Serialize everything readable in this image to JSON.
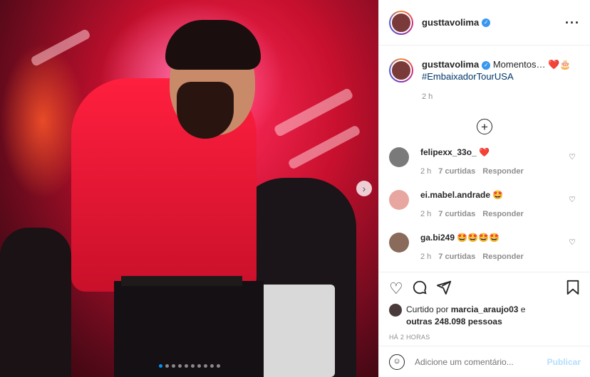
{
  "post": {
    "author": "gusttavolima",
    "caption_text": "Momentos… ",
    "caption_emoji": "❤️🎂",
    "hashtag": "#EmbaixadorTourUSA",
    "time": "2 h"
  },
  "comments": [
    {
      "user": "felipexx_33o_",
      "text": "❤️",
      "time": "2 h",
      "likes": "7 curtidas",
      "reply": "Responder"
    },
    {
      "user": "ei.mabel.andrade",
      "text": "🤩",
      "time": "2 h",
      "likes": "7 curtidas",
      "reply": "Responder"
    },
    {
      "user": "ga.bi249",
      "text": "🤩🤩🤩🤩",
      "time": "2 h",
      "likes": "7 curtidas",
      "reply": "Responder"
    }
  ],
  "likes": {
    "prefix": "Curtido por ",
    "user": "marcia_araujo03",
    "middle": " e",
    "others": "outras 248.098 pessoas"
  },
  "posted_ago": "HÁ 2 HORAS",
  "add_comment": {
    "placeholder": "Adicione um comentário...",
    "publish": "Publicar"
  },
  "icons": {
    "more": "more-icon",
    "like": "heart-icon",
    "comment": "comment-icon",
    "share": "share-icon",
    "save": "bookmark-icon",
    "emoji": "emoji-icon",
    "next": "chevron-right-icon",
    "load_more": "plus-circle-icon"
  },
  "colors": {
    "verified": "#3897f0",
    "link": "#00376b",
    "meta": "#8e8e8e",
    "publish_disabled": "#b2dffc",
    "active_dot": "#0095f6"
  },
  "carousel": {
    "total": 10,
    "active": 1
  }
}
